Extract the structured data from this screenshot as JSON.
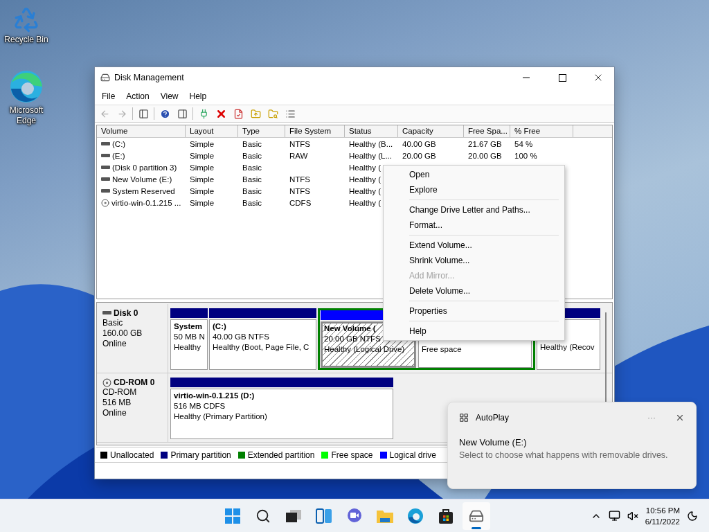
{
  "desktop_icons": [
    {
      "kind": "recycle",
      "label": "Recycle Bin"
    },
    {
      "kind": "edge",
      "label": "Microsoft Edge"
    }
  ],
  "window": {
    "title": "Disk Management",
    "menu": [
      "File",
      "Action",
      "View",
      "Help"
    ],
    "toolbar": [
      {
        "kind": "back",
        "disabled": true
      },
      {
        "kind": "forward",
        "disabled": true
      },
      {
        "kind": "sep"
      },
      {
        "kind": "panel-left",
        "disabled": false
      },
      {
        "kind": "sep"
      },
      {
        "kind": "help",
        "disabled": false
      },
      {
        "kind": "panel-right",
        "disabled": false
      },
      {
        "kind": "sep"
      },
      {
        "kind": "connect",
        "disabled": false
      },
      {
        "kind": "delete",
        "disabled": false
      },
      {
        "kind": "check",
        "disabled": false
      },
      {
        "kind": "folder-up",
        "disabled": false
      },
      {
        "kind": "folder-search",
        "disabled": false
      },
      {
        "kind": "list",
        "disabled": false
      }
    ],
    "table": {
      "columns": [
        "Volume",
        "Layout",
        "Type",
        "File System",
        "Status",
        "Capacity",
        "Free Spa...",
        "% Free"
      ],
      "rows": [
        {
          "kind": "disk",
          "cells": [
            "(C:)",
            "Simple",
            "Basic",
            "NTFS",
            "Healthy (B...",
            "40.00 GB",
            "21.67 GB",
            "54 %"
          ]
        },
        {
          "kind": "disk",
          "cells": [
            "(E:)",
            "Simple",
            "Basic",
            "RAW",
            "Healthy (L...",
            "20.00 GB",
            "20.00 GB",
            "100 %"
          ]
        },
        {
          "kind": "disk",
          "cells": [
            "(Disk 0 partition 3)",
            "Simple",
            "Basic",
            "",
            "Healthy ("
          ]
        },
        {
          "kind": "disk",
          "cells": [
            "New Volume (E:)",
            "Simple",
            "Basic",
            "NTFS",
            "Healthy ("
          ]
        },
        {
          "kind": "disk",
          "cells": [
            "System Reserved",
            "Simple",
            "Basic",
            "NTFS",
            "Healthy ("
          ]
        },
        {
          "kind": "cdrom",
          "cells": [
            "virtio-win-0.1.215 ...",
            "Simple",
            "Basic",
            "CDFS",
            "Healthy ("
          ]
        }
      ]
    },
    "disks": [
      {
        "kind": "disk",
        "name": "Disk 0",
        "lines": [
          "Basic",
          "160.00 GB",
          "Online"
        ],
        "partitions": [
          {
            "kind": "primary",
            "selected": false,
            "title": "System",
            "size": "50 MB N",
            "status": "Healthy"
          },
          {
            "kind": "primary",
            "selected": false,
            "title": "(C:)",
            "size": "40.00 GB NTFS",
            "status": "Healthy (Boot, Page File, C"
          },
          {
            "kind": "extended",
            "children": [
              {
                "kind": "logical",
                "selected": true,
                "title": "New Volume  (",
                "size": "20.00 GB NTFS",
                "status": "Healthy (Logical Drive)"
              },
              {
                "kind": "free",
                "selected": false,
                "status": "Free space"
              }
            ]
          },
          {
            "kind": "primary",
            "selected": false,
            "status": "Healthy (Recov"
          }
        ]
      },
      {
        "kind": "cdrom",
        "name": "CD-ROM 0",
        "lines": [
          "CD-ROM",
          "516 MB",
          "Online"
        ],
        "partitions": [
          {
            "kind": "primary",
            "selected": false,
            "title": "virtio-win-0.1.215  (D:)",
            "size": "516 MB CDFS",
            "status": "Healthy (Primary Partition)"
          }
        ]
      }
    ],
    "legend": [
      {
        "label": "Unallocated",
        "color": "#000000"
      },
      {
        "label": "Primary partition",
        "color": "#000080"
      },
      {
        "label": "Extended partition",
        "color": "#008000"
      },
      {
        "label": "Free space",
        "color": "#00ff00"
      },
      {
        "label": "Logical drive",
        "color": "#0000ff"
      }
    ]
  },
  "context_menu": {
    "groups": [
      {
        "items": [
          {
            "label": "Open",
            "disabled": false
          },
          {
            "label": "Explore",
            "disabled": false
          }
        ]
      },
      {
        "items": [
          {
            "label": "Change Drive Letter and Paths...",
            "disabled": false
          },
          {
            "label": "Format...",
            "disabled": false
          }
        ]
      },
      {
        "items": [
          {
            "label": "Extend Volume...",
            "disabled": false
          },
          {
            "label": "Shrink Volume...",
            "disabled": false
          },
          {
            "label": "Add Mirror...",
            "disabled": true
          },
          {
            "label": "Delete Volume...",
            "disabled": false
          }
        ]
      },
      {
        "items": [
          {
            "label": "Properties",
            "disabled": false
          }
        ]
      },
      {
        "items": [
          {
            "label": "Help",
            "disabled": false
          }
        ]
      }
    ]
  },
  "toast": {
    "app": "AutoPlay",
    "more": "···",
    "heading": "New Volume (E:)",
    "body": "Select to choose what happens with removable drives."
  },
  "taskbar": {
    "apps": [
      {
        "kind": "start",
        "active": false
      },
      {
        "kind": "search",
        "active": false
      },
      {
        "kind": "task-view",
        "active": false
      },
      {
        "kind": "widgets",
        "active": false
      },
      {
        "kind": "chat",
        "active": false
      },
      {
        "kind": "explorer",
        "active": false
      },
      {
        "kind": "edge",
        "active": false
      },
      {
        "kind": "store",
        "active": false
      },
      {
        "kind": "disk-management",
        "active": true
      }
    ],
    "time": "10:56 PM",
    "date": "6/11/2022"
  }
}
